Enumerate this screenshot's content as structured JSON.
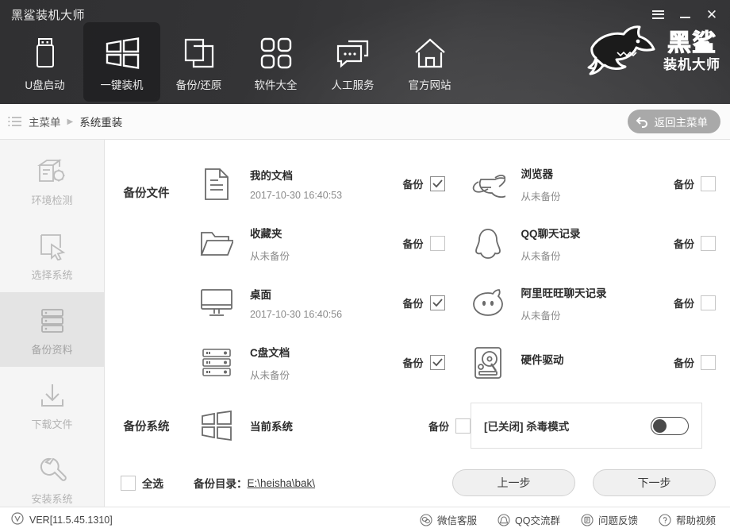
{
  "window": {
    "title": "黑鲨装机大师",
    "controls": [
      {
        "name": "menu",
        "icon": "hamburger-icon"
      },
      {
        "name": "minimize",
        "icon": "minimize-icon"
      },
      {
        "name": "close",
        "icon": "close-icon"
      }
    ]
  },
  "brand": {
    "line1": "黑鲨",
    "line2": "装机大师",
    "logo": "shark-logo"
  },
  "nav": {
    "items": [
      {
        "label": "U盘启动",
        "icon": "usb-drive-icon",
        "active": false
      },
      {
        "label": "一键装机",
        "icon": "windows-icon",
        "active": true
      },
      {
        "label": "备份/还原",
        "icon": "copy-icon",
        "active": false
      },
      {
        "label": "软件大全",
        "icon": "grid-apps-icon",
        "active": false
      },
      {
        "label": "人工服务",
        "icon": "chat-bubble-icon",
        "active": false
      },
      {
        "label": "官方网站",
        "icon": "home-icon",
        "active": false
      }
    ]
  },
  "breadcrumb": {
    "menu_icon": "list-menu-icon",
    "root": "主菜单",
    "separator": "▶",
    "current": "系统重装",
    "back_button": {
      "label": "返回主菜单",
      "icon": "back-arrow-icon"
    }
  },
  "sidebar": {
    "items": [
      {
        "label": "环境检测",
        "icon": "environment-check-icon",
        "active": false
      },
      {
        "label": "选择系统",
        "icon": "select-system-icon",
        "active": false
      },
      {
        "label": "备份资料",
        "icon": "backup-data-icon",
        "active": true
      },
      {
        "label": "下载文件",
        "icon": "download-icon",
        "active": false
      },
      {
        "label": "安装系统",
        "icon": "wrench-icon",
        "active": false
      }
    ]
  },
  "main": {
    "backup_files_label": "备份文件",
    "backup_system_label": "备份系统",
    "checkbox_label": "备份",
    "files_left": [
      {
        "name": "我的文档",
        "meta": "2017-10-30 16:40:53",
        "icon": "document-icon",
        "checked": true
      },
      {
        "name": "收藏夹",
        "meta": "从未备份",
        "icon": "folder-icon",
        "checked": false
      },
      {
        "name": "桌面",
        "meta": "2017-10-30 16:40:56",
        "icon": "monitor-icon",
        "checked": true
      },
      {
        "name": "C盘文档",
        "meta": "从未备份",
        "icon": "disk-stack-icon",
        "checked": true
      }
    ],
    "files_right": [
      {
        "name": "浏览器",
        "meta": "从未备份",
        "icon": "internet-explorer-icon",
        "checked": false
      },
      {
        "name": "QQ聊天记录",
        "meta": "从未备份",
        "icon": "qq-penguin-icon",
        "checked": false
      },
      {
        "name": "阿里旺旺聊天记录",
        "meta": "从未备份",
        "icon": "aliwangwang-icon",
        "checked": false
      },
      {
        "name": "硬件驱动",
        "meta": "",
        "icon": "hard-drive-icon",
        "checked": false
      }
    ],
    "system_row": {
      "name": "当前系统",
      "icon": "windows-logo-icon",
      "checked": false
    },
    "antivirus": {
      "label": "[已关闭] 杀毒模式",
      "enabled": false
    }
  },
  "actions": {
    "select_all_label": "全选",
    "select_all_checked": false,
    "backup_dir_label": "备份目录：",
    "backup_dir_path": "E:\\heisha\\bak\\",
    "prev_button": "上一步",
    "next_button": "下一步"
  },
  "footer": {
    "version": "VER[11.5.45.1310]",
    "version_icon": "v-circle-icon",
    "links": [
      {
        "label": "微信客服",
        "icon": "wechat-icon"
      },
      {
        "label": "QQ交流群",
        "icon": "qq-group-icon"
      },
      {
        "label": "问题反馈",
        "icon": "feedback-icon"
      },
      {
        "label": "帮助视频",
        "icon": "help-icon"
      }
    ]
  },
  "colors": {
    "header_bg": "#3a3a3c",
    "sidebar_bg": "#f5f5f5",
    "active_side": "#e4e4e4",
    "accent": "#a9a9a9"
  }
}
